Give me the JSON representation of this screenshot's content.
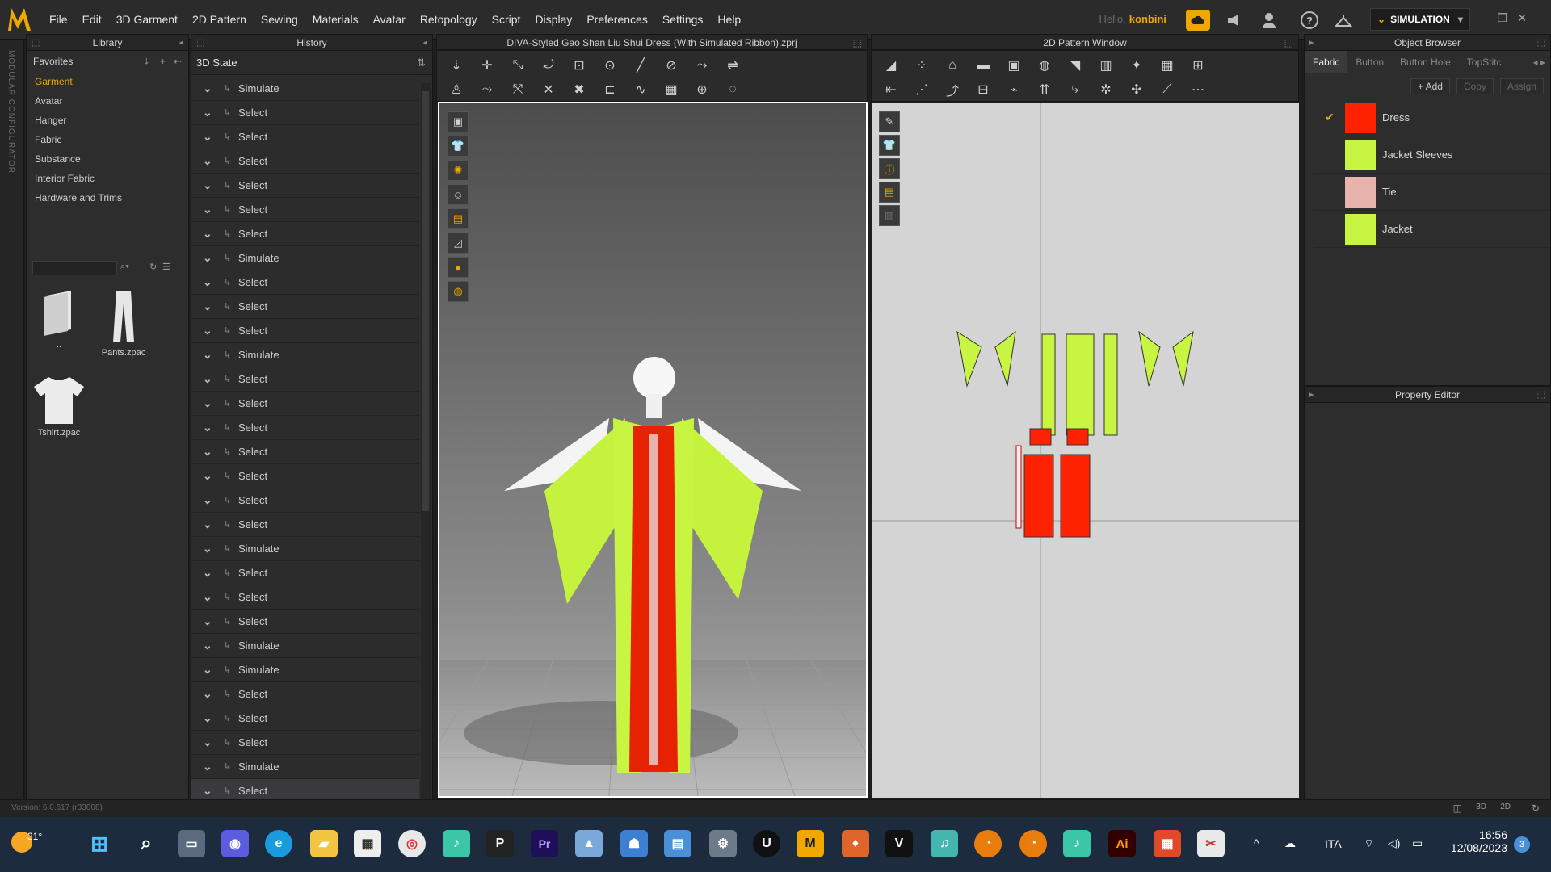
{
  "menubar": {
    "items": [
      "File",
      "Edit",
      "3D Garment",
      "2D Pattern",
      "Sewing",
      "Materials",
      "Avatar",
      "Retopology",
      "Script",
      "Display",
      "Preferences",
      "Settings",
      "Help"
    ],
    "hello": "Hello,",
    "user": "konbini",
    "mode": "SIMULATION"
  },
  "library": {
    "title": "Library",
    "favorites": "Favorites",
    "categories": [
      "Garment",
      "Avatar",
      "Hanger",
      "Fabric",
      "Substance",
      "Interior Fabric",
      "Hardware and Trims"
    ],
    "files": [
      {
        "name": "..",
        "icon": "folder-icon"
      },
      {
        "name": "Pants.zpac",
        "icon": "pants-icon"
      },
      {
        "name": "Tshirt.zpac",
        "icon": "tshirt-icon"
      }
    ],
    "vertical_label": "MODULAR CONFIGURATOR"
  },
  "history": {
    "title": "History",
    "state": "3D State",
    "entries": [
      "Simulate",
      "Select",
      "Select",
      "Select",
      "Select",
      "Select",
      "Select",
      "Simulate",
      "Select",
      "Select",
      "Select",
      "Simulate",
      "Select",
      "Select",
      "Select",
      "Select",
      "Select",
      "Select",
      "Select",
      "Simulate",
      "Select",
      "Select",
      "Select",
      "Simulate",
      "Simulate",
      "Select",
      "Select",
      "Select",
      "Simulate",
      "Select"
    ]
  },
  "view3d": {
    "title": "DIVA-Styled Gao Shan Liu Shui Dress (With Simulated Ribbon).zprj"
  },
  "pattern2d": {
    "title": "2D Pattern Window"
  },
  "object_browser": {
    "title": "Object Browser",
    "tabs": [
      "Fabric",
      "Button",
      "Button Hole",
      "TopStitc"
    ],
    "actions": [
      "+ Add",
      "Copy",
      "Assign"
    ],
    "fabrics": [
      {
        "name": "Dress",
        "color": "#ff2200",
        "checked": true
      },
      {
        "name": "Jacket Sleeves",
        "color": "#c8f542",
        "checked": false
      },
      {
        "name": "Tie",
        "color": "#e8b2ad",
        "checked": false
      },
      {
        "name": "Jacket",
        "color": "#c8f542",
        "checked": false
      }
    ]
  },
  "property_editor": {
    "title": "Property Editor"
  },
  "status": {
    "version": "Version: 6.0.617 (r33008)"
  },
  "taskbar": {
    "temperature": "31°",
    "language": "ITA",
    "time": "16:56",
    "date": "12/08/2023",
    "notification_count": "3"
  }
}
